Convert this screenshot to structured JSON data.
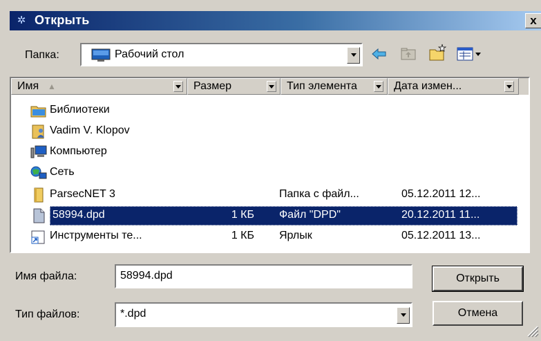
{
  "window": {
    "title": "Открыть",
    "close_label": "x"
  },
  "lookin": {
    "label": "Папка:",
    "value": "Рабочий стол"
  },
  "toolbar": {
    "back_icon": "back-arrow-icon",
    "up_icon": "up-folder-icon",
    "new_folder_icon": "new-folder-icon",
    "view_icon": "view-menu-icon"
  },
  "columns": {
    "name": "Имя",
    "size": "Размер",
    "type": "Тип элемента",
    "date": "Дата измен..."
  },
  "files": [
    {
      "name": "Библиотеки",
      "size": "",
      "type": "",
      "date": "",
      "icon": "libraries-icon"
    },
    {
      "name": "Vadim V. Klopov",
      "size": "",
      "type": "",
      "date": "",
      "icon": "user-folder-icon"
    },
    {
      "name": "Компьютер",
      "size": "",
      "type": "",
      "date": "",
      "icon": "computer-icon"
    },
    {
      "name": "Сеть",
      "size": "",
      "type": "",
      "date": "",
      "icon": "network-icon"
    },
    {
      "name": "ParsecNET 3",
      "size": "",
      "type": "Папка с файл...",
      "date": "05.12.2011 12...",
      "icon": "folder-icon"
    },
    {
      "name": "58994.dpd",
      "size": "1 КБ",
      "type": "Файл \"DPD\"",
      "date": "20.12.2011 11...",
      "icon": "file-icon",
      "selected": true
    },
    {
      "name": "Инструменты те...",
      "size": "1 КБ",
      "type": "Ярлык",
      "date": "05.12.2011 13...",
      "icon": "shortcut-icon"
    }
  ],
  "filename": {
    "label": "Имя файла:",
    "value": "58994.dpd"
  },
  "filetype": {
    "label": "Тип файлов:",
    "value": "*.dpd"
  },
  "buttons": {
    "open": "Открыть",
    "cancel": "Отмена"
  }
}
